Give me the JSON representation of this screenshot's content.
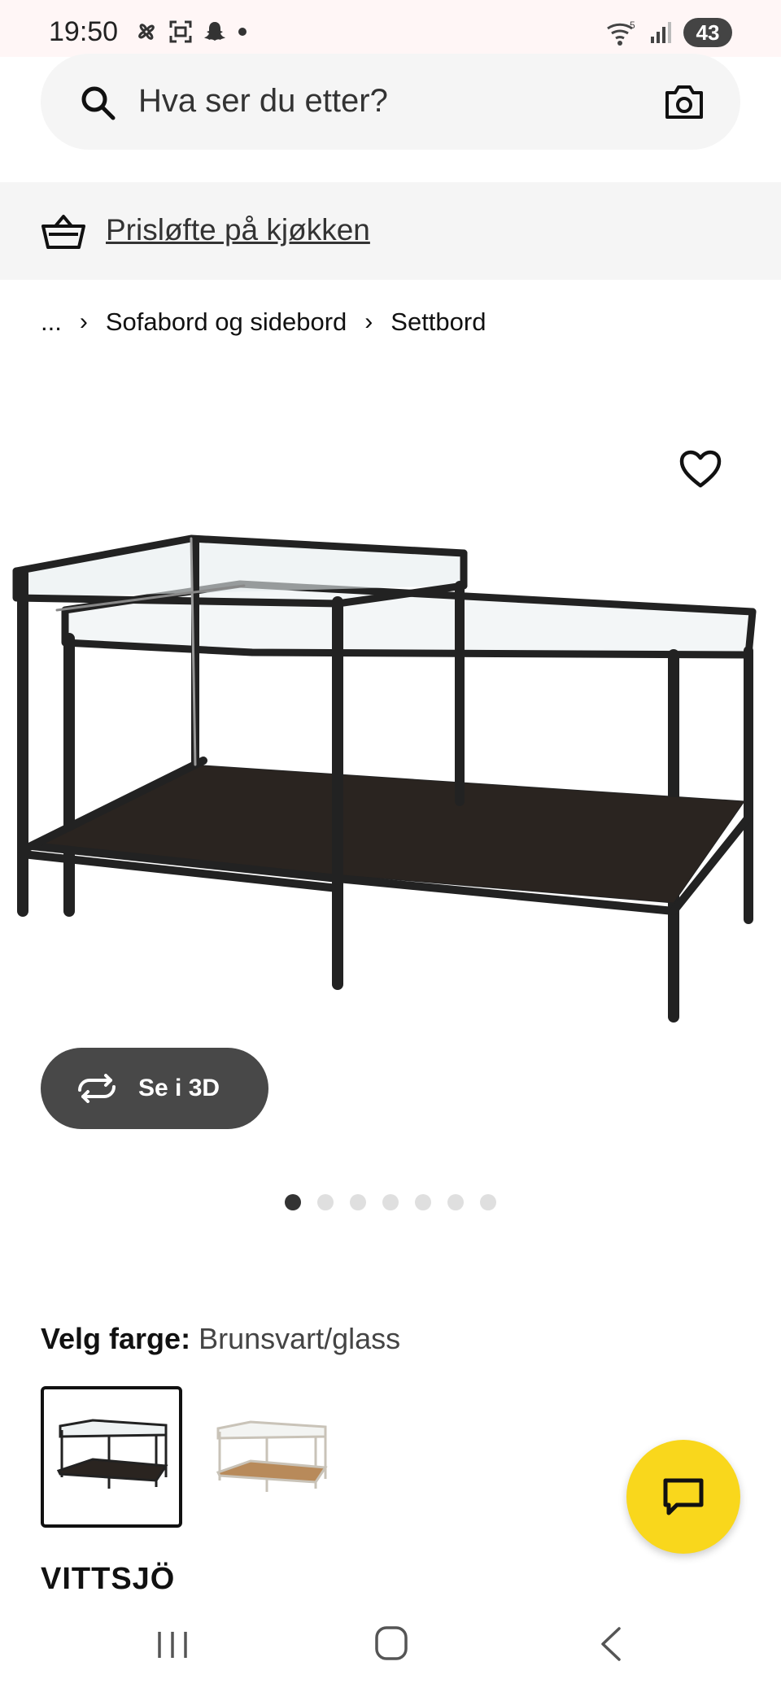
{
  "status_bar": {
    "time": "19:50",
    "battery": "43"
  },
  "search": {
    "placeholder": "Hva ser du etter?"
  },
  "promo": {
    "link_text": "Prisløfte på kjøkken"
  },
  "breadcrumb": {
    "ellipsis": "...",
    "separator": "›",
    "items": [
      "Sofabord og sidebord",
      "Settbord"
    ]
  },
  "gallery": {
    "view_3d_label": "Se i 3D",
    "image_count": 7,
    "active_index": 0
  },
  "color": {
    "label": "Velg farge:",
    "value": "Brunsvart/glass",
    "options": [
      "Brunsvart/glass",
      "Hvit/glass"
    ]
  },
  "product": {
    "name": "VITTSJÖ"
  },
  "colors": {
    "chat_button": "#f9d71c",
    "dark_button": "#484848"
  },
  "icons": [
    "search-icon",
    "camera-icon",
    "basket-icon",
    "heart-icon",
    "rotate-icon",
    "chat-icon"
  ]
}
